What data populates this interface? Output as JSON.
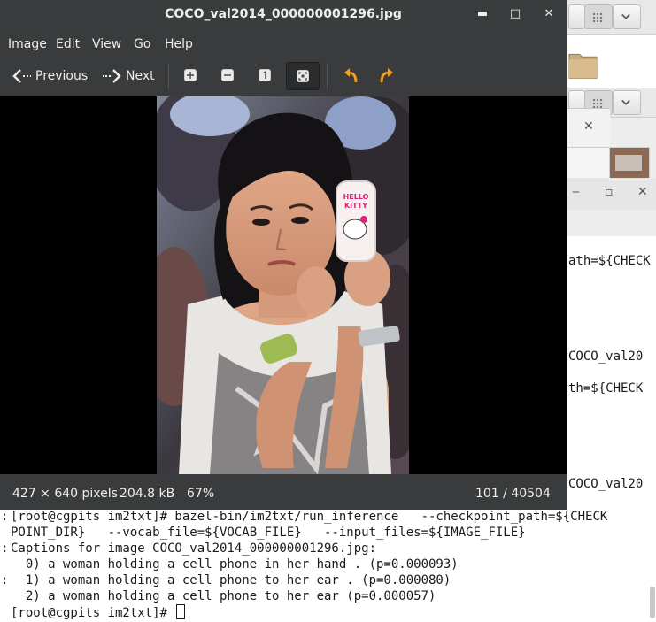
{
  "viewer": {
    "title": "COCO_val2014_000000001296.jpg",
    "controls": {
      "minimize": "▪",
      "maximize": "▫",
      "close": "✕"
    },
    "menu": [
      "Image",
      "Edit",
      "View",
      "Go",
      "Help"
    ],
    "toolbar": {
      "previous_label": "Previous",
      "next_label": "Next",
      "zoom_buttons": [
        "zoom-in-icon",
        "zoom-out-icon",
        "zoom-normal-icon",
        "zoom-fit-icon"
      ],
      "active_zoom": "zoom-fit-icon",
      "rotate_buttons": [
        "rotate-left-icon",
        "rotate-right-icon"
      ]
    },
    "status": {
      "dimensions": "427 × 640 pixels",
      "filesize": "204.8 kB",
      "zoom": "67%",
      "position": "101 / 40504"
    },
    "photo_phone_text": "HELLO KITTY"
  },
  "background_terminal": {
    "lines": [
      "ath=${CHECK",
      "COCO_val20",
      "th=${CHECK",
      "COCO_val20"
    ]
  },
  "terminal": {
    "prompt_line": "[root@cgpits im2txt]# bazel-bin/im2txt/run_inference   --checkpoint_path=${CHECK",
    "prompt_line_2": "POINT_DIR}   --vocab_file=${VOCAB_FILE}   --input_files=${IMAGE_FILE}",
    "captions_header": "Captions for image COCO_val2014_000000001296.jpg:",
    "captions": [
      "  0) a woman holding a cell phone in her hand . (p=0.000093)",
      "  1) a woman holding a cell phone to her ear . (p=0.000080)",
      "  2) a woman holding a cell phone to her ear (p=0.000057)"
    ],
    "final_prompt": "[root@cgpits im2txt]# "
  },
  "colors": {
    "viewer_chrome": "#393b3c",
    "titlebar": "#3a3d3e",
    "rotate_arrow": "#f0a020"
  }
}
